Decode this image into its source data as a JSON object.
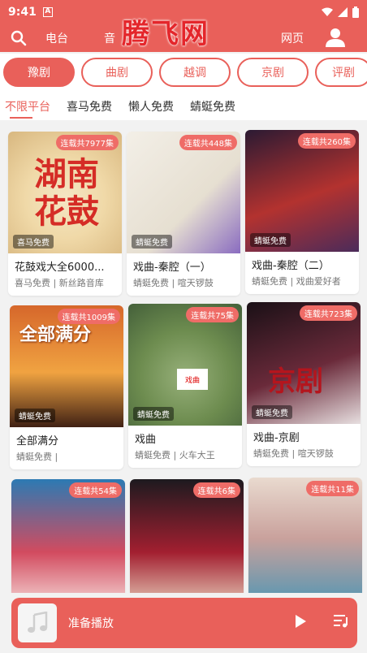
{
  "status_bar": {
    "time": "9:41",
    "indicator": "A"
  },
  "top_nav": {
    "items": [
      "电台",
      "音",
      "网页"
    ]
  },
  "watermark": "腾飞网",
  "genres": [
    {
      "label": "豫剧",
      "active": true
    },
    {
      "label": "曲剧",
      "active": false
    },
    {
      "label": "越调",
      "active": false
    },
    {
      "label": "京剧",
      "active": false
    },
    {
      "label": "评剧",
      "active": false
    }
  ],
  "platforms": [
    {
      "label": "不限平台",
      "active": true
    },
    {
      "label": "喜马免费",
      "active": false
    },
    {
      "label": "懒人免费",
      "active": false
    },
    {
      "label": "蜻蜓免费",
      "active": false
    }
  ],
  "cards": [
    {
      "title": "花鼓戏大全6000...",
      "subtitle": "喜马免费 | 新丝路音库",
      "badge": "连载共7977集",
      "platform_label": "喜马免费",
      "cover_text": "湖南花鼓"
    },
    {
      "title": "戏曲-秦腔（一）",
      "subtitle": "蜻蜓免费 | 喧天锣鼓",
      "badge": "连载共448集",
      "platform_label": "蜻蜓免费",
      "cover_text": ""
    },
    {
      "title": "戏曲-秦腔（二）",
      "subtitle": "蜻蜓免费 | 戏曲爱好者",
      "badge": "连载共260集",
      "platform_label": "蜻蜓免费",
      "cover_text": ""
    },
    {
      "title": "全部满分",
      "subtitle": "蜻蜓免费 |",
      "badge": "连载共1009集",
      "platform_label": "蜻蜓免费",
      "cover_text": "全部满分"
    },
    {
      "title": "戏曲",
      "subtitle": "蜻蜓免费 | 火车大王",
      "badge": "连载共75集",
      "platform_label": "蜻蜓免费",
      "cover_text": "戏曲"
    },
    {
      "title": "戏曲-京剧",
      "subtitle": "蜻蜓免费 | 喧天锣鼓",
      "badge": "连载共723集",
      "platform_label": "蜻蜓免费",
      "cover_text": "京剧"
    },
    {
      "title": "",
      "subtitle": "",
      "badge": "连载共54集",
      "platform_label": "",
      "cover_text": ""
    },
    {
      "title": "",
      "subtitle": "",
      "badge": "连载共6集",
      "platform_label": "",
      "cover_text": ""
    },
    {
      "title": "",
      "subtitle": "",
      "badge": "连载共11集",
      "platform_label": "",
      "cover_text": ""
    }
  ],
  "player": {
    "title": "准备播放"
  },
  "colors": {
    "accent": "#e9605a",
    "badge": "#ef6c67",
    "watermark": "#e4262b"
  },
  "icons": [
    "search-icon",
    "user-icon",
    "music-note-icon",
    "play-icon",
    "playlist-icon",
    "wifi-icon",
    "signal-icon",
    "battery-icon"
  ]
}
